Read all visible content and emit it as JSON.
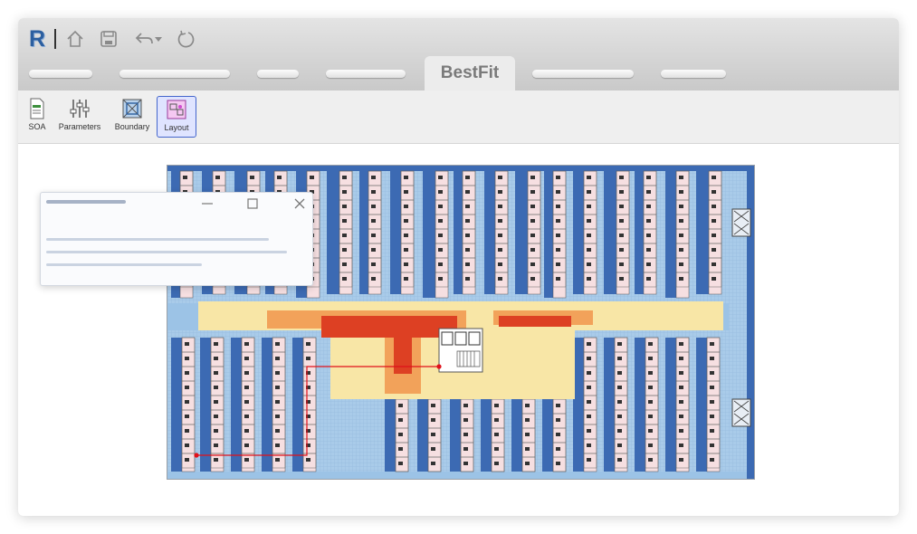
{
  "app": {
    "logo_letter": "R",
    "brand_color": "#2c5fa0"
  },
  "quick_access": [
    {
      "name": "home-icon"
    },
    {
      "name": "save-icon"
    },
    {
      "name": "undo-icon"
    },
    {
      "name": "dropdown-caret-icon"
    },
    {
      "name": "refresh-icon"
    }
  ],
  "tabs": {
    "active_label": "BestFit"
  },
  "ribbon": {
    "buttons": [
      {
        "label": "SOA",
        "icon": "document-icon"
      },
      {
        "label": "Parameters",
        "icon": "sliders-icon"
      },
      {
        "label": "Boundary",
        "icon": "boundary-icon"
      },
      {
        "label": "Layout",
        "icon": "layout-icon",
        "active": true
      }
    ]
  },
  "colors": {
    "accent": "#4466cc",
    "desk_blue": "#3c6ab3",
    "light_blue": "#9cc3e6",
    "room_pink": "#f6dfe1",
    "heat_yellow": "#f8e6a6",
    "heat_orange": "#f2a25a",
    "heat_red": "#dd4023",
    "path_red": "#e0101a"
  }
}
